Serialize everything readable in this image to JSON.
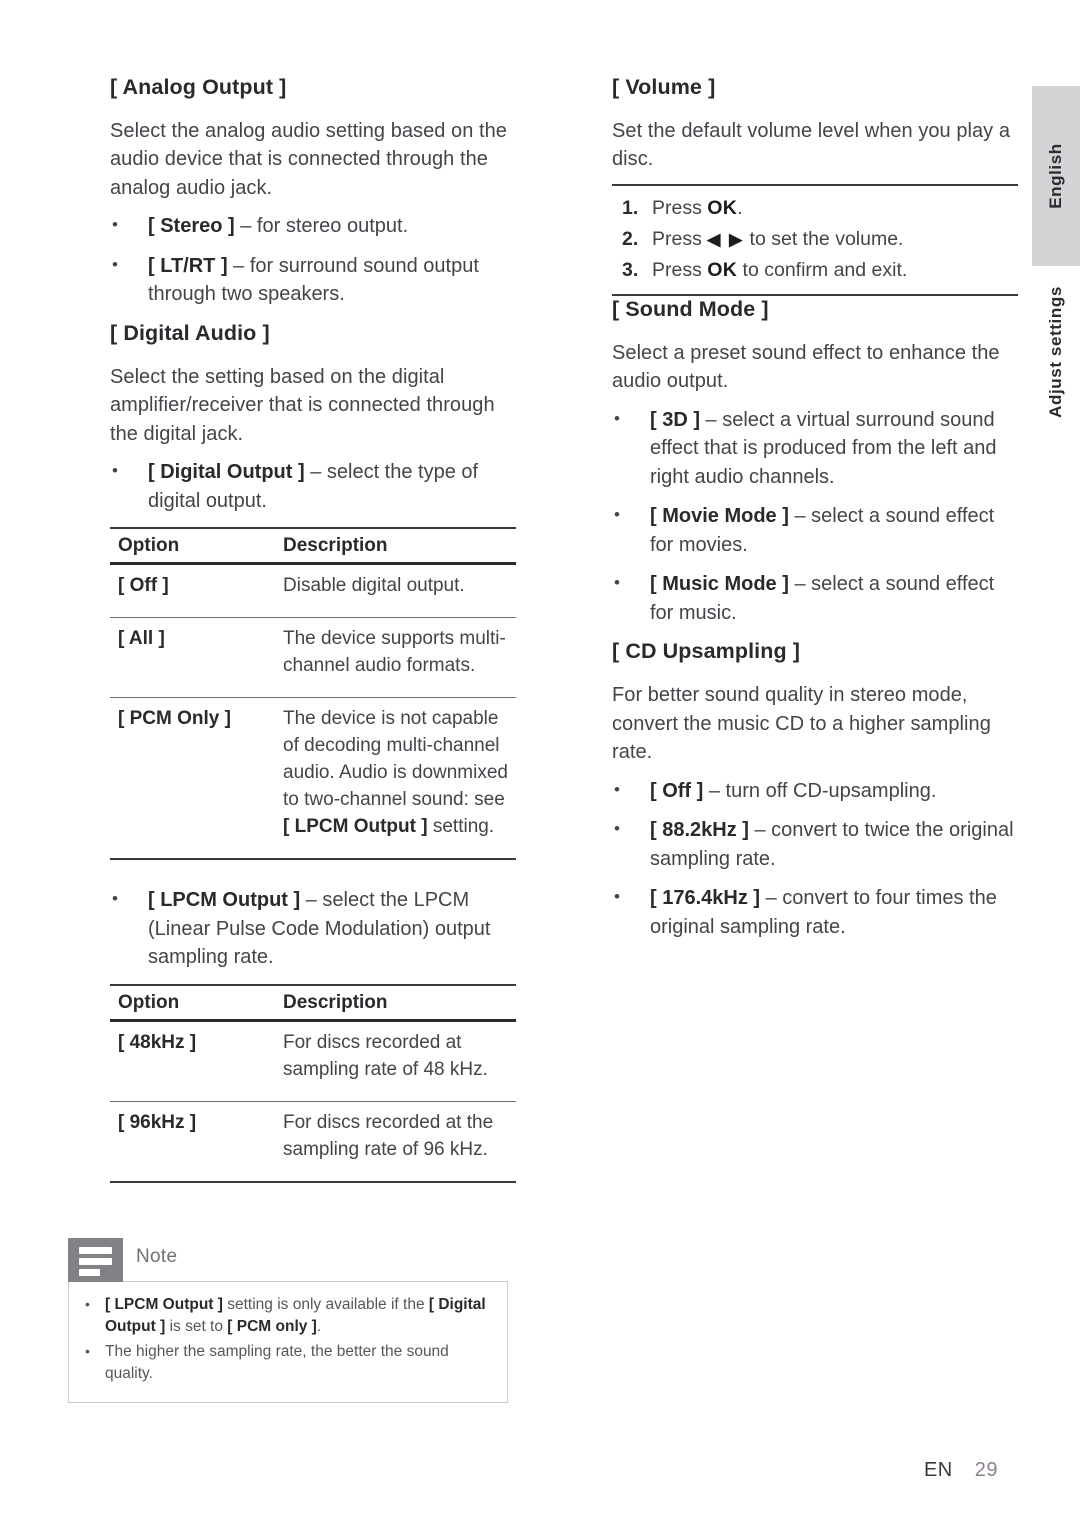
{
  "side_tabs": {
    "language": "English",
    "chapter": "Adjust settings"
  },
  "footer": {
    "language_code": "EN",
    "page_number": "29"
  },
  "left_column": {
    "analog_output": {
      "heading": "[ Analog Output ]",
      "intro": "Select the analog audio setting based on the audio device that is connected through the analog audio jack.",
      "bullets": [
        {
          "term": "[ Stereo ]",
          "desc": " – for stereo output."
        },
        {
          "term": "[ LT/RT ]",
          "desc": " – for surround sound output through two speakers."
        }
      ]
    },
    "digital_audio": {
      "heading": "[ Digital Audio ]",
      "intro": "Select the setting based on the digital amplifier/receiver that is connected through the digital jack.",
      "bullet_digital_output": {
        "term": "[ Digital Output ]",
        "desc": " – select the type of digital output."
      },
      "table_digital_output": {
        "headers": [
          "Option",
          "Description"
        ],
        "rows": [
          {
            "option": "[ Off ]",
            "description": "Disable digital output."
          },
          {
            "option": "[ All ]",
            "description": "The device supports multi-channel audio formats."
          },
          {
            "option": "[ PCM Only ]",
            "description_pre": "The device is not capable of decoding multi-channel audio. Audio is downmixed to two-channel sound: see ",
            "description_bold": "[ LPCM Output ]",
            "description_post": " setting."
          }
        ]
      },
      "bullet_lpcm_output": {
        "term": "[ LPCM Output ]",
        "desc": " – select the LPCM (Linear Pulse Code Modulation) output sampling rate."
      },
      "table_lpcm_output": {
        "headers": [
          "Option",
          "Description"
        ],
        "rows": [
          {
            "option": "[ 48kHz ]",
            "description": "For discs recorded at sampling rate of 48 kHz."
          },
          {
            "option": "[ 96kHz ]",
            "description": "For discs recorded at the sampling rate of 96 kHz."
          }
        ]
      }
    },
    "note": {
      "icon": "note-lines-icon",
      "title": "Note",
      "items": [
        {
          "bold_1": "[ LPCM Output ]",
          "text_1": " setting is only available if the ",
          "bold_2": "[ Digital Output ]",
          "text_2": " is set to ",
          "bold_3": "[ PCM only ]",
          "text_3": "."
        },
        {
          "text_1": "The higher the sampling rate, the better the sound quality."
        }
      ]
    }
  },
  "right_column": {
    "volume": {
      "heading": "[ Volume ]",
      "intro": "Set the default volume level when you play a disc.",
      "steps": [
        {
          "number": "1.",
          "pre": "Press ",
          "key": "OK",
          "post": "."
        },
        {
          "number": "2.",
          "pre": "Press ",
          "key": "◀ ▶",
          "post": " to set the volume."
        },
        {
          "number": "3.",
          "pre": "Press ",
          "key": "OK",
          "post": " to confirm and exit."
        }
      ]
    },
    "sound_mode": {
      "heading": "[ Sound Mode ]",
      "intro": "Select a preset sound effect to enhance the audio output.",
      "bullets": [
        {
          "term": "[ 3D ]",
          "desc": " – select a virtual surround sound effect that is produced from the left and right audio channels."
        },
        {
          "term": "[ Movie Mode ]",
          "desc": " – select a sound effect for movies."
        },
        {
          "term": "[ Music Mode ]",
          "desc": " – select a sound effect for music."
        }
      ]
    },
    "cd_upsampling": {
      "heading": "[ CD Upsampling ]",
      "intro": "For better sound quality in stereo mode, convert the music CD to a higher sampling rate.",
      "bullets": [
        {
          "term": "[ Off ]",
          "desc": " – turn off CD-upsampling."
        },
        {
          "term": "[ 88.2kHz ]",
          "desc": " – convert to twice the original sampling rate."
        },
        {
          "term": "[ 176.4kHz ]",
          "desc": " – convert to four times the original sampling rate."
        }
      ]
    }
  }
}
